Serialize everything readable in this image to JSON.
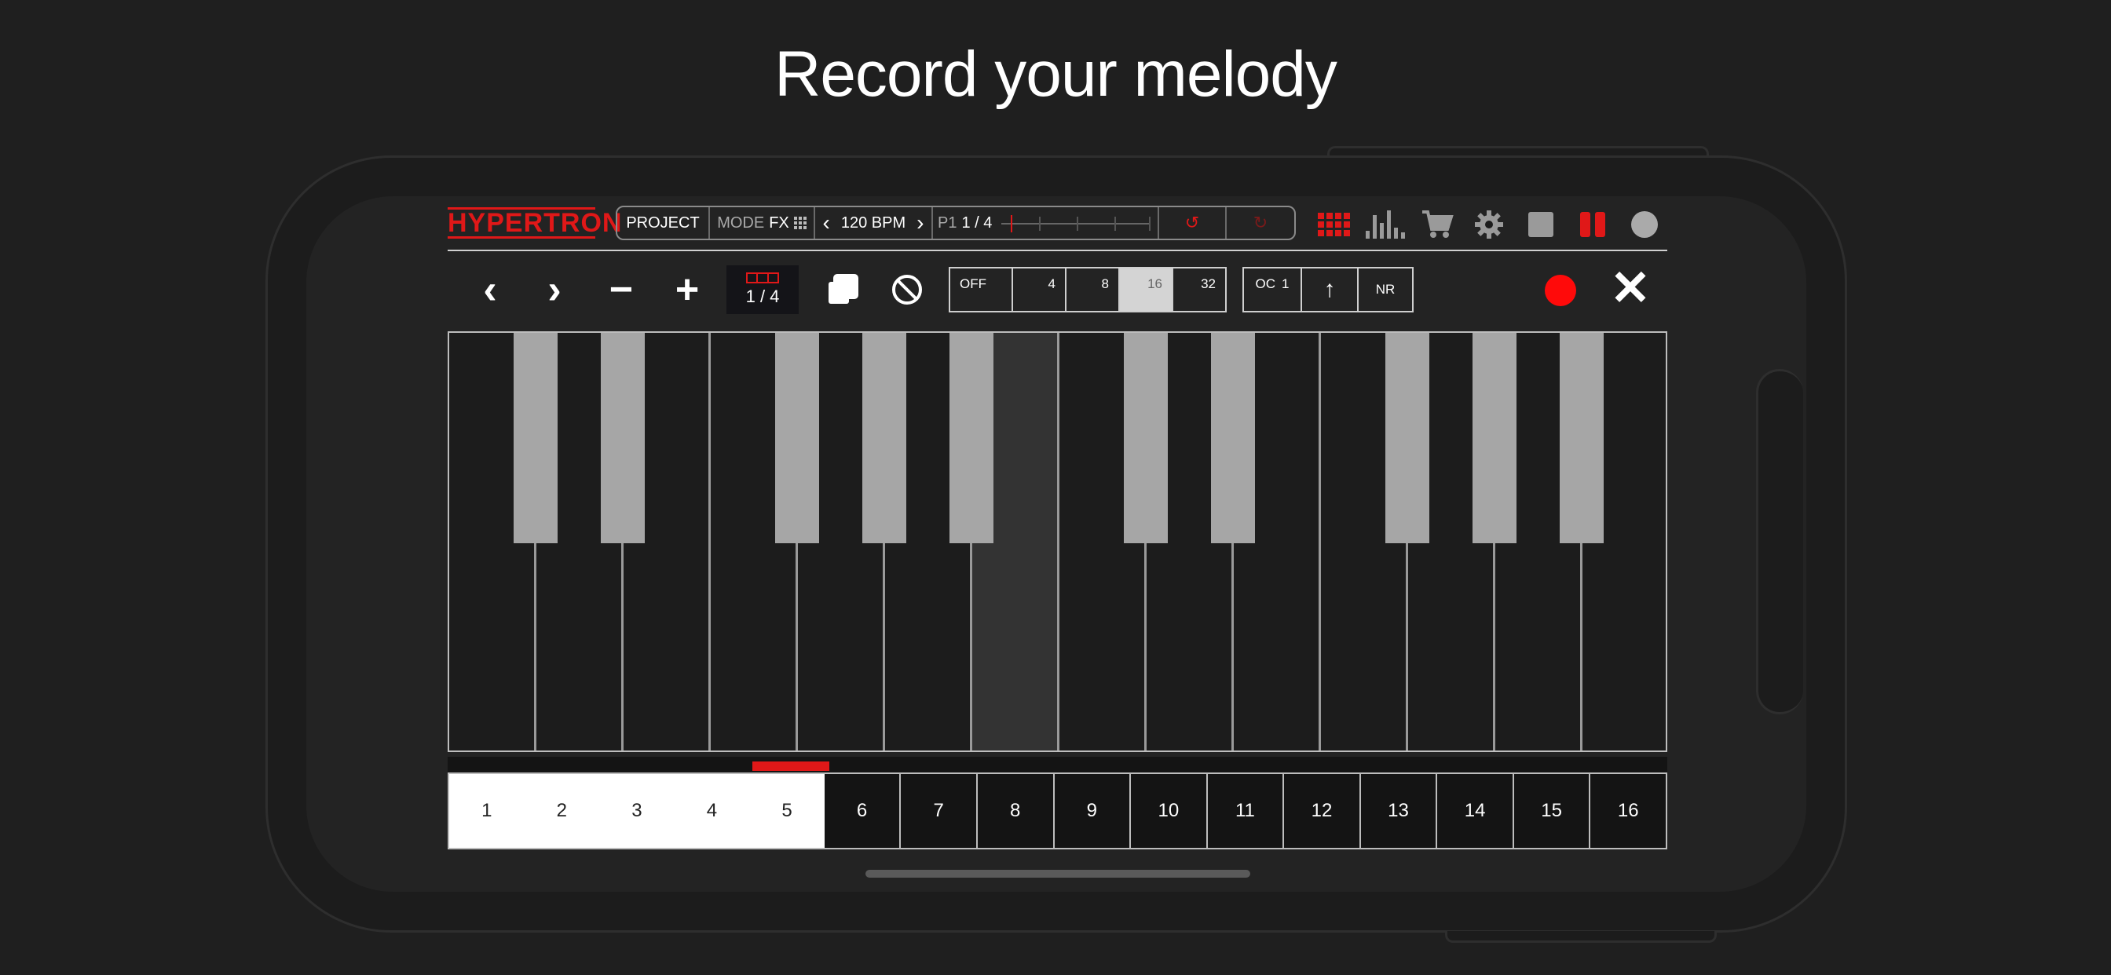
{
  "headline": "Record your melody",
  "logo": "HYPERTRON",
  "toolbar": {
    "project": "PROJECT",
    "mode_label": "MODE",
    "mode_value": "FX",
    "bpm_prev": "‹",
    "bpm": "120 BPM",
    "bpm_next": "›",
    "pattern_prefix": "P1",
    "pattern_value": "1 / 4",
    "undo": "↺",
    "redo": "↻"
  },
  "icons": [
    "grid-icon",
    "mixer-icon",
    "cart-icon",
    "gear-icon",
    "stop-icon",
    "pause-icon",
    "record-indicator-icon"
  ],
  "colors": {
    "accent": "#e01818",
    "background": "#1f1f1f",
    "white_key_highlight": "#333333"
  },
  "row2": {
    "prev": "‹",
    "next": "›",
    "minus": "−",
    "plus": "+",
    "pager": "1 / 4",
    "quantize": [
      "OFF",
      "4",
      "8",
      "16",
      "32"
    ],
    "quantize_active": "16",
    "octave_label": "OC",
    "octave_value": "1",
    "octave_up": "↑",
    "nr": "NR",
    "close": "✕"
  },
  "steps": [
    "1",
    "2",
    "3",
    "4",
    "5",
    "6",
    "7",
    "8",
    "9",
    "10",
    "11",
    "12",
    "13",
    "14",
    "15",
    "16"
  ],
  "steps_active_count": 5
}
